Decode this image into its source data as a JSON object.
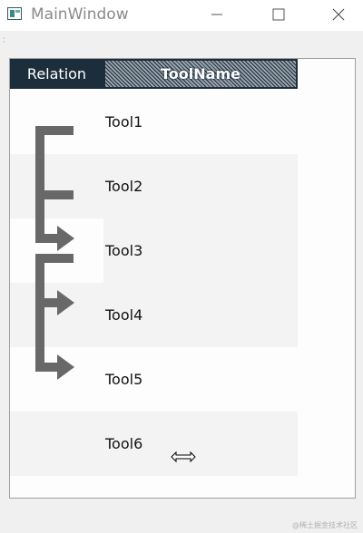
{
  "window": {
    "title": "MainWindow",
    "minimize_icon": "minimize-icon",
    "maximize_icon": "maximize-icon",
    "close_icon": "close-icon"
  },
  "toolbar": {
    "grip_icon": "drag-grip-icon"
  },
  "grid": {
    "columns": [
      {
        "label": "Relation"
      },
      {
        "label": "ToolName"
      }
    ],
    "rows": [
      {
        "name": "Tool1",
        "shade": "#fdfdfd"
      },
      {
        "name": "Tool2",
        "shade": "#f3f3f3"
      },
      {
        "name": "Tool3",
        "shade": "#f3f3f3"
      },
      {
        "name": "Tool4",
        "shade": "#f3f3f3"
      },
      {
        "name": "Tool5",
        "shade": "#fdfdfd"
      },
      {
        "name": "Tool6",
        "shade": "#f3f3f3"
      }
    ],
    "colors": {
      "header_bg": "#1c2e3c",
      "relation_line": "#686868"
    }
  },
  "cursor": {
    "icon": "resize-horizontal-cursor-icon"
  },
  "watermark": "@稀土掘金技术社区"
}
